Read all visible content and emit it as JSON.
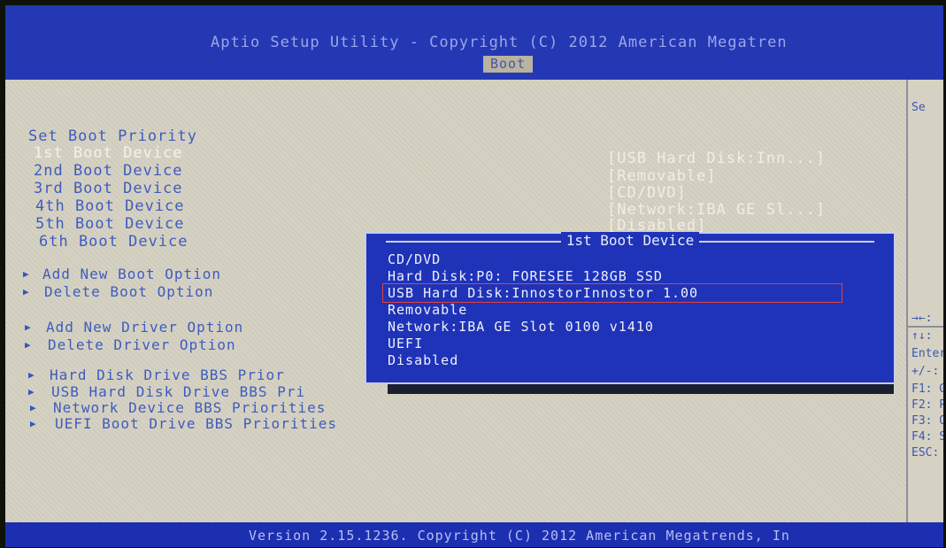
{
  "header": {
    "title": "Aptio Setup Utility - Copyright (C) 2012 American Megatren",
    "active_tab": "Boot"
  },
  "boot": {
    "section_title": "Set Boot Priority",
    "devices": [
      {
        "label": "1st Boot Device",
        "value": "[USB Hard Disk:Inn...]"
      },
      {
        "label": "2nd Boot Device",
        "value": "[Removable]"
      },
      {
        "label": "3rd Boot Device",
        "value": "[CD/DVD]"
      },
      {
        "label": "4th Boot Device",
        "value": "[Network:IBA GE Sl...]"
      },
      {
        "label": "5th Boot Device",
        "value": "[Disabled]"
      },
      {
        "label": "6th Boot Device",
        "value": ""
      }
    ],
    "submenus": [
      "Add New Boot Option",
      "Delete Boot Option",
      "Add New Driver Option",
      "Delete Driver Option",
      "Hard Disk Drive BBS Prior",
      "USB Hard Disk Drive BBS Pri",
      "Network Device BBS Priorities",
      "UEFI Boot Drive BBS Priorities"
    ]
  },
  "popup": {
    "title": "1st Boot Device",
    "options": [
      "CD/DVD",
      "Hard Disk:P0: FORESEE 128GB SSD",
      "USB Hard Disk:InnostorInnostor 1.00",
      "Removable",
      "Network:IBA GE Slot 0100 v1410",
      "UEFI",
      "Disabled"
    ],
    "selected_index": 2,
    "highlight_color": "#e0423c"
  },
  "help": {
    "top": "Se",
    "keys": [
      "→←: ",
      "↑↓: ",
      "Enter",
      "+/-: ",
      "F1: G",
      "F2: P",
      "F3: O",
      "F4: S",
      "ESC: "
    ]
  },
  "footer": {
    "text": "Version 2.15.1236. Copyright (C) 2012 American Megatrends, In"
  },
  "colors": {
    "screen_blue": "#1c2a9a",
    "panel_beige": "#d6d2c3",
    "label_blue": "#3e5cbf"
  }
}
